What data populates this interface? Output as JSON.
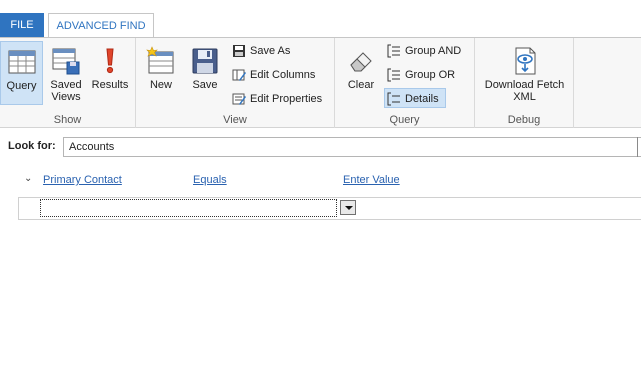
{
  "tabs": {
    "file": "FILE",
    "advanced_find": "ADVANCED FIND"
  },
  "ribbon": {
    "show": {
      "label": "Show",
      "query": "Query",
      "saved_views_1": "Saved",
      "saved_views_2": "Views",
      "results": "Results"
    },
    "view": {
      "label": "View",
      "new": "New",
      "save": "Save",
      "save_as": "Save As",
      "edit_columns": "Edit Columns",
      "edit_properties": "Edit Properties"
    },
    "query": {
      "label": "Query",
      "clear": "Clear",
      "group_and": "Group AND",
      "group_or": "Group OR",
      "details": "Details"
    },
    "debug": {
      "label": "Debug",
      "download_1": "Download Fetch",
      "download_2": "XML"
    }
  },
  "look_for": {
    "label": "Look for:",
    "value": "Accounts"
  },
  "criteria": {
    "field": "Primary Contact",
    "operator": "Equals",
    "value": "Enter Value"
  },
  "colors": {
    "accent": "#2f74c0",
    "link": "#2a62b0",
    "active_bg": "#cfe3f6"
  }
}
